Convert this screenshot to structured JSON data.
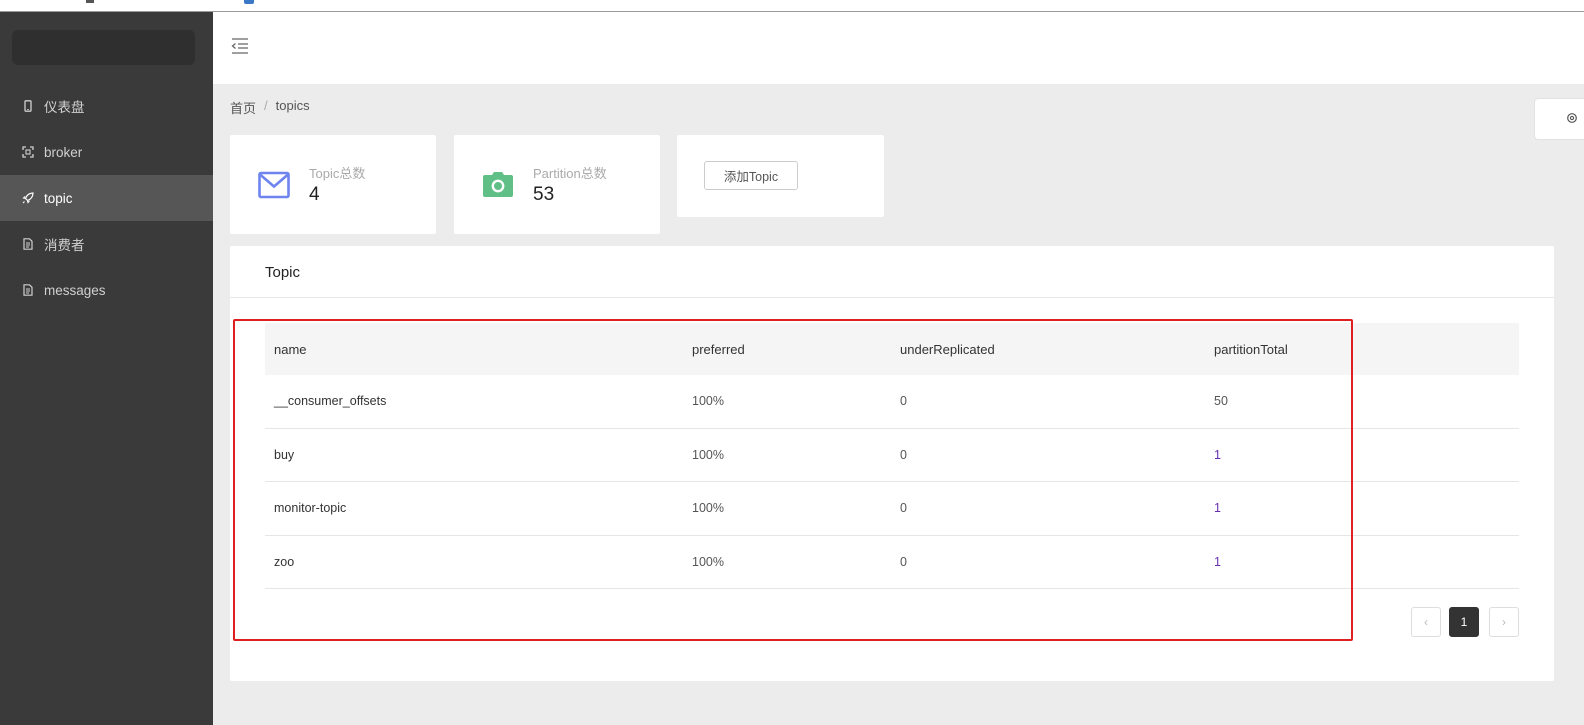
{
  "sidebar": {
    "items": [
      {
        "label": "仪表盘",
        "icon": "phone-icon",
        "active": false
      },
      {
        "label": "broker",
        "icon": "scan-icon",
        "active": false
      },
      {
        "label": "topic",
        "icon": "rocket-icon",
        "active": true
      },
      {
        "label": "消费者",
        "icon": "document-icon",
        "active": false
      },
      {
        "label": "messages",
        "icon": "document-icon",
        "active": false
      }
    ]
  },
  "breadcrumb": {
    "home": "首页",
    "separator": "/",
    "current": "topics"
  },
  "stats": {
    "topic_label": "Topic总数",
    "topic_count": "4",
    "partition_label": "Partition总数",
    "partition_count": "53",
    "add_button": "添加Topic"
  },
  "topic_panel": {
    "title": "Topic",
    "columns": [
      "name",
      "preferred",
      "underReplicated",
      "partitionTotal"
    ],
    "rows": [
      {
        "name": "__consumer_offsets",
        "preferred": "100%",
        "underReplicated": "0",
        "partitionTotal": "50"
      },
      {
        "name": "buy",
        "preferred": "100%",
        "underReplicated": "0",
        "partitionTotal": "1"
      },
      {
        "name": "monitor-topic",
        "preferred": "100%",
        "underReplicated": "0",
        "partitionTotal": "1"
      },
      {
        "name": "zoo",
        "preferred": "100%",
        "underReplicated": "0",
        "partitionTotal": "1"
      }
    ]
  },
  "pagination": {
    "prev": "‹",
    "current_page": "1",
    "next": "›"
  },
  "colors": {
    "sidebar_bg": "#3a3a3a",
    "active_item_bg": "#565656",
    "mail_icon": "#6e84ee",
    "camera_icon": "#5fbf86",
    "link": "#6a2fb0",
    "highlight": "#e02020"
  }
}
